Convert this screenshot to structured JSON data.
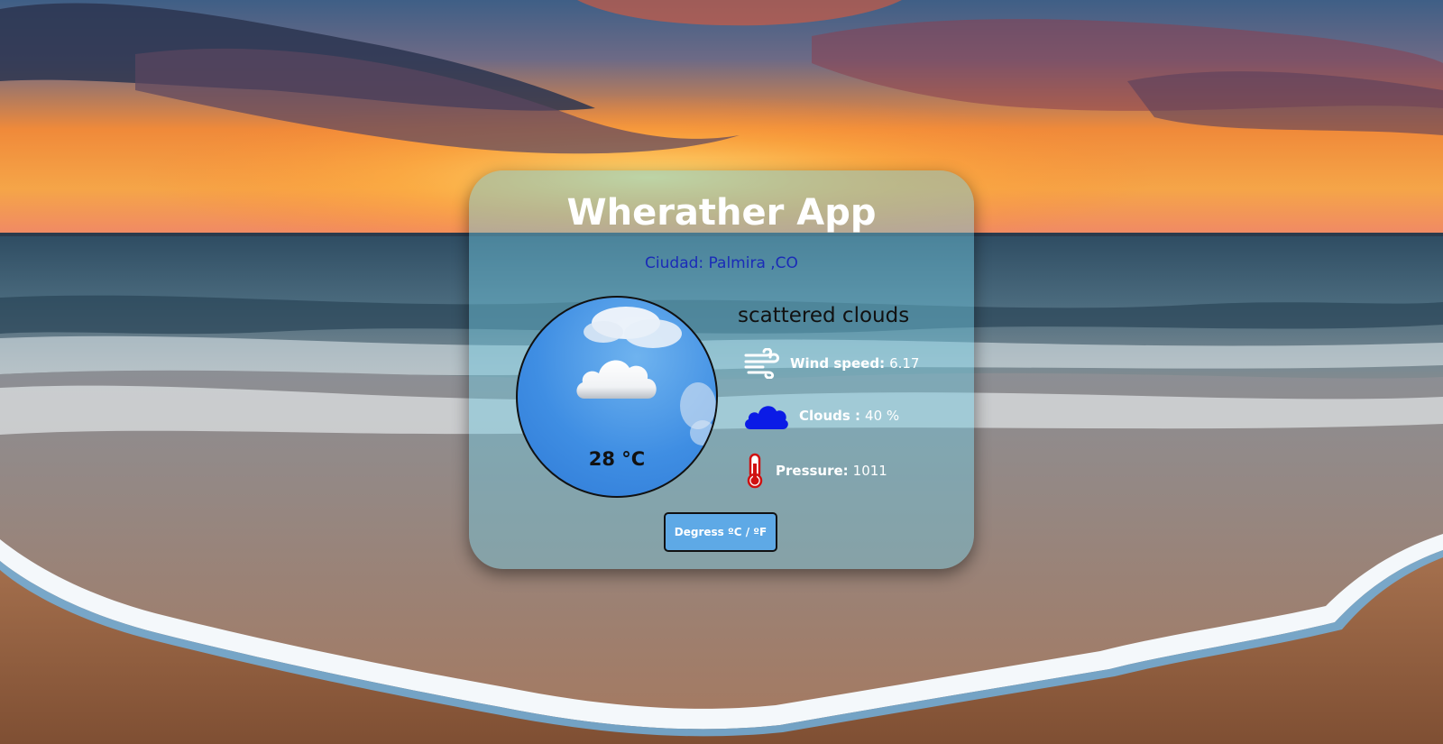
{
  "app": {
    "title": "Wherather App"
  },
  "location": {
    "city_line": "Ciudad: Palmira ,CO"
  },
  "weather": {
    "description": "scattered clouds",
    "temperature": "28 °C",
    "icon": "cloud-icon"
  },
  "stats": {
    "wind": {
      "label": "Wind speed:",
      "value": "6.17",
      "icon": "wind-icon"
    },
    "clouds": {
      "label": "Clouds :",
      "value": "40 %",
      "icon": "cloud-blue-icon"
    },
    "pressure": {
      "label": "Pressure:",
      "value": "1011",
      "icon": "thermometer-icon"
    }
  },
  "controls": {
    "units_toggle_label": "Degress ºC / ºF"
  },
  "colors": {
    "city_text": "#1a2bb8",
    "clouds_icon": "#0b1be6",
    "thermometer": "#d01010",
    "button_bg": "#5ea9e6"
  }
}
